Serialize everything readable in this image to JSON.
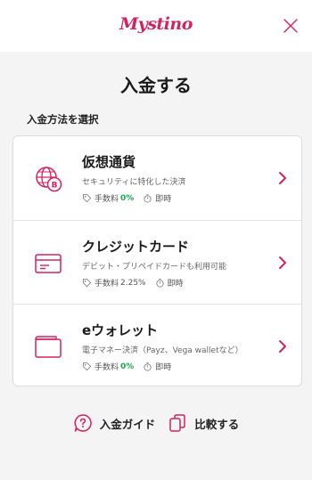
{
  "header": {
    "logo_text": "Mystino",
    "brand_color": "#d6215f",
    "close_icon": "close-icon"
  },
  "page": {
    "title": "入金する",
    "section_label": "入金方法を選択"
  },
  "methods": [
    {
      "title": "仮想通貨",
      "description": "セキュリティに特化した決済",
      "fee_label": "手数料",
      "fee_value": "0%",
      "time_label": "即時",
      "icon": "crypto-globe-icon"
    },
    {
      "title": "クレジットカード",
      "description": "デビット・プリペイドカードも利用可能",
      "fee_label": "手数料",
      "fee_value": "2.25%",
      "time_label": "即時",
      "icon": "credit-card-icon"
    },
    {
      "title": "eウォレット",
      "description": "電子マネー決済（Payz、Vega walletなど）",
      "fee_label": "手数料",
      "fee_value": "0%",
      "time_label": "即時",
      "icon": "wallet-icon"
    }
  ],
  "footer": {
    "guide_label": "入金ガイド",
    "compare_label": "比較する"
  },
  "colors": {
    "accent": "#d6215f",
    "fee_free": "#1fa84f"
  }
}
